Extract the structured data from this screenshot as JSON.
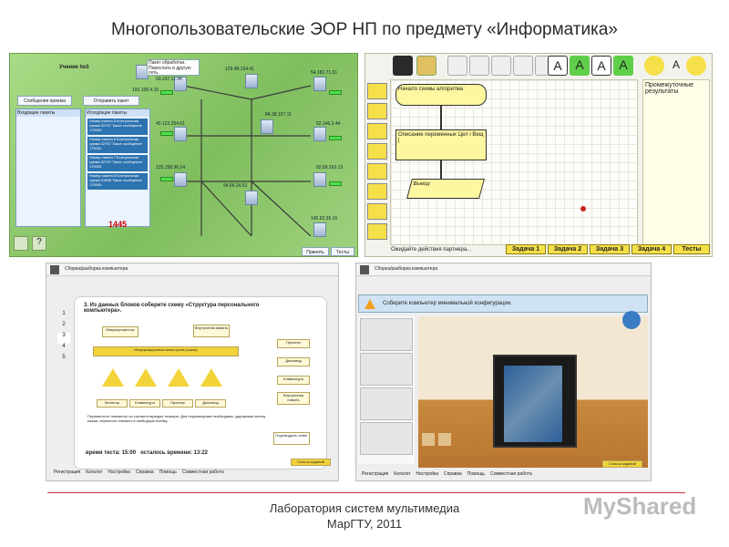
{
  "slide": {
    "title": "Многопользовательские ЭОР НП по предмету «Информатика»",
    "footer_line1": "Лаборатория систем мультимедиа",
    "footer_line2": "МарГТУ, 2011",
    "watermark": "MyShared"
  },
  "network_panel": {
    "student": "Ученик №5",
    "student_ip": "192.168.4.15",
    "btn_receive": "Сообщения приема",
    "btn_send": "Отправить пакет",
    "incoming_title": "Входящие пакеты",
    "outgoing_title": "Исходящие пакеты",
    "popup_text": "Пакет обработан. Переслать в другую сеть.",
    "counter": "1445",
    "ips": [
      "93.237.11.94",
      "129.48.154.41",
      "54.181.71.51",
      "84.38.157.11",
      "45.122.254.61",
      "94.66.14.51",
      "52.146.3.44",
      "125.158.96.14",
      "92.89.163.13",
      "145.62.35.16",
      "92.68.144.21",
      "26.26.154.11"
    ],
    "incoming_packets": [
      "Номер пакета 5\nКонтрольная сумма 32767\nТакое сообщение 170000",
      "Номер пакета 6\nКонтрольная сумма 32767\nТакое сообщение 170000",
      "Номер пакета 7\nКонтрольная сумма 32767\nТакое сообщение 170000",
      "Номер пакета 8\nКонтрольная сумма 21698\nТакое сообщение 170000"
    ],
    "bottom_btns": [
      "Принять",
      "Тесты"
    ]
  },
  "flow_panel": {
    "side_title": "Промежуточные результаты",
    "status": "Ожидайте действия партнера...",
    "blocks": [
      "Начало схемы алгоритма",
      "Описание переменных Цел i Вещ j",
      "Вывод"
    ],
    "tabs": [
      "Задача 1",
      "Задача 2",
      "Задача 3",
      "Задача 4",
      "Тесты"
    ],
    "letters": [
      "A",
      "A",
      "A",
      "A",
      "A",
      "A"
    ]
  },
  "test_panel": {
    "window_title": "Сборка/разборка компьютера",
    "question": "3. Из данных блоков соберите схему «Структура персонального компьютера».",
    "nav": [
      "1",
      "2",
      "3",
      "4",
      "5"
    ],
    "blocks": {
      "mp": "Микропроцессор",
      "mem": "Внутренняя память",
      "bus": "Информационная магистраль (шина)"
    },
    "controllers": [
      "Контроллер",
      "Контроллер",
      "Контроллер",
      "Контроллер"
    ],
    "devices_bottom": [
      "Монитор",
      "Клавиатура",
      "Принтер",
      "Дисковод"
    ],
    "right_blocks": [
      "Принтер",
      "Дисковод",
      "Клавиатура",
      "Внутренняя память"
    ],
    "hint": "Переместите элементы на соответствующие позиции. Для перемещения необходимо, удерживая кнопку мыши, перенести элемент в свободную ячейку.",
    "confirm": "Подтвердить ответ",
    "time_label": "время теста:",
    "time_value": "15:00",
    "left_label": "осталось времени:",
    "left_value": "13:22",
    "list_btn": "Список заданий",
    "menu": [
      "Регистрация",
      "Каталог",
      "Настройка",
      "Справка",
      "Помощь",
      "Совместная работа"
    ]
  },
  "assembly_panel": {
    "window_title": "Сборка/разборка компьютера",
    "task": "Соберите компьютер минимальной конфигурации.",
    "list_btn": "Список заданий",
    "menu": [
      "Регистрация",
      "Каталог",
      "Настройка",
      "Справка",
      "Помощь",
      "Совместная работа"
    ]
  }
}
